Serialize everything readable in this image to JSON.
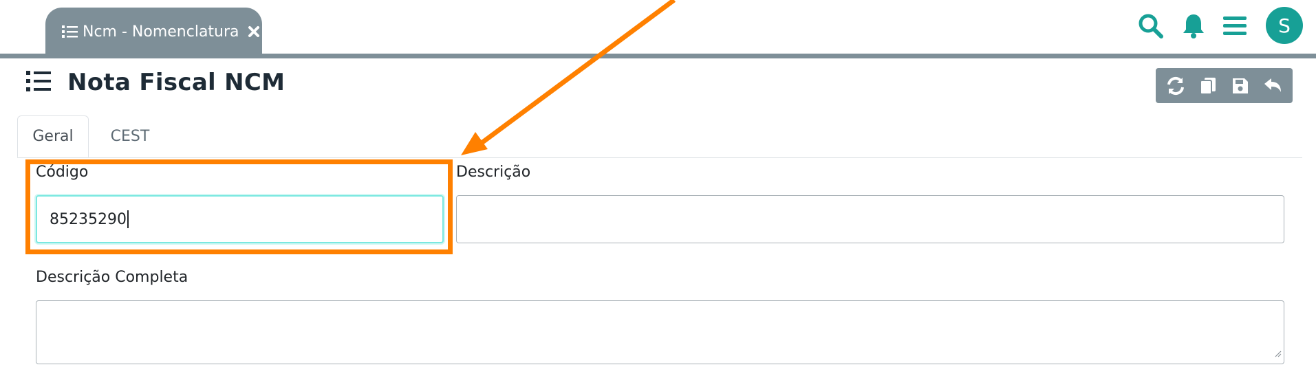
{
  "tab_bar": {
    "open_tab_label": "Ncm - Nomenclatura"
  },
  "header": {
    "avatar_initial": "S",
    "icons": [
      "search-icon",
      "bell-icon",
      "menu-icon"
    ]
  },
  "page": {
    "title": "Nota Fiscal NCM",
    "toolbar_icons": [
      "refresh-icon",
      "copy-icon",
      "save-icon",
      "undo-icon"
    ]
  },
  "tabs": {
    "items": [
      {
        "label": "Geral",
        "active": true
      },
      {
        "label": "CEST",
        "active": false
      }
    ]
  },
  "form": {
    "codigo": {
      "label": "Código",
      "value": "85235290"
    },
    "descricao": {
      "label": "Descrição",
      "value": ""
    },
    "descricao_completa": {
      "label": "Descrição Completa",
      "value": ""
    }
  },
  "colors": {
    "accent": "#17a096",
    "tab_bar": "#7e8f98",
    "annotation": "#ff8000",
    "focus": "#7ae8e0"
  }
}
